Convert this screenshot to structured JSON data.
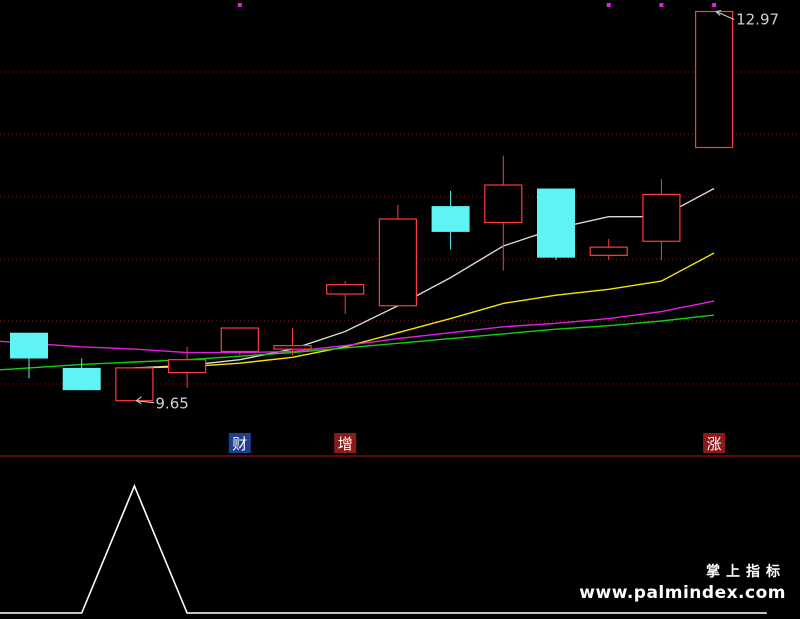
{
  "chart_data": [
    {
      "type": "candlestick",
      "ylim": [
        9.4,
        13.0
      ],
      "colors": {
        "up": "#ff3b3b",
        "down": "#5ef4f4",
        "ma_white": "#d8d8d8",
        "ma_yellow": "#f5e600",
        "ma_magenta": "#e020e0",
        "ma_green": "#10d010",
        "grid": "#8a1616",
        "label_blue_bg": "#1e3f8e",
        "label_red_bg": "#8b1a1a"
      },
      "candles": [
        {
          "open": 10.23,
          "high": 10.23,
          "low": 9.84,
          "close": 10.01
        },
        {
          "open": 9.93,
          "high": 10.01,
          "low": 9.74,
          "close": 9.74
        },
        {
          "open": 9.65,
          "high": 9.93,
          "low": 9.65,
          "close": 9.93
        },
        {
          "open": 9.89,
          "high": 10.11,
          "low": 9.76,
          "close": 10.0
        },
        {
          "open": 10.07,
          "high": 10.27,
          "low": 10.04,
          "close": 10.27
        },
        {
          "open": 10.09,
          "high": 10.27,
          "low": 10.04,
          "close": 10.12
        },
        {
          "open": 10.56,
          "high": 10.67,
          "low": 10.39,
          "close": 10.64
        },
        {
          "open": 10.46,
          "high": 11.32,
          "low": 10.46,
          "close": 11.2
        },
        {
          "open": 11.31,
          "high": 11.44,
          "low": 10.94,
          "close": 11.09
        },
        {
          "open": 11.17,
          "high": 11.74,
          "low": 10.76,
          "close": 11.49
        },
        {
          "open": 11.46,
          "high": 11.46,
          "low": 10.85,
          "close": 10.87
        },
        {
          "open": 10.89,
          "high": 11.03,
          "low": 10.85,
          "close": 10.96
        },
        {
          "open": 11.01,
          "high": 11.54,
          "low": 10.85,
          "close": 11.41
        },
        {
          "open": 11.81,
          "high": 12.97,
          "low": 11.81,
          "close": 12.97
        }
      ],
      "ma_lines": [
        {
          "color": "white",
          "values": [
            null,
            null,
            9.93,
            9.95,
            10.0,
            10.09,
            10.24,
            10.46,
            10.7,
            10.97,
            11.12,
            11.22,
            11.22,
            11.46
          ]
        },
        {
          "color": "yellow",
          "values": [
            null,
            null,
            9.93,
            9.94,
            9.97,
            10.02,
            10.11,
            10.23,
            10.35,
            10.48,
            10.55,
            10.6,
            10.67,
            10.91
          ]
        },
        {
          "color": "magenta",
          "values": [
            10.14,
            10.11,
            10.09,
            10.06,
            10.06,
            10.07,
            10.12,
            10.18,
            10.23,
            10.28,
            10.31,
            10.35,
            10.41,
            10.5
          ]
        },
        {
          "color": "green",
          "values": [
            9.93,
            9.96,
            9.98,
            10.0,
            10.03,
            10.06,
            10.1,
            10.14,
            10.18,
            10.22,
            10.26,
            10.29,
            10.33,
            10.38
          ]
        }
      ],
      "annotations": [
        {
          "text": "12.97",
          "candle": 13,
          "kind": "high"
        },
        {
          "text": "9.65",
          "candle": 2,
          "kind": "low"
        }
      ],
      "markers": [
        {
          "text": "财",
          "candle": 4,
          "style": "blue"
        },
        {
          "text": "增",
          "candle": 6,
          "style": "red"
        },
        {
          "text": "涨",
          "candle": 13,
          "style": "red"
        }
      ],
      "top_dots": [
        4,
        11,
        12,
        13
      ]
    },
    {
      "type": "line",
      "ylim": [
        0,
        1
      ],
      "x": [
        -1,
        0,
        1,
        2,
        3,
        4,
        5,
        6,
        7,
        8,
        9,
        10,
        11,
        12,
        13,
        14
      ],
      "values": [
        0,
        0,
        0,
        1,
        0,
        0,
        0,
        0,
        0,
        0,
        0,
        0,
        0,
        0,
        0,
        0
      ],
      "color": "#ffffff"
    }
  ],
  "watermark": {
    "cn": "掌上指标",
    "url": "www.palmindex.com"
  }
}
